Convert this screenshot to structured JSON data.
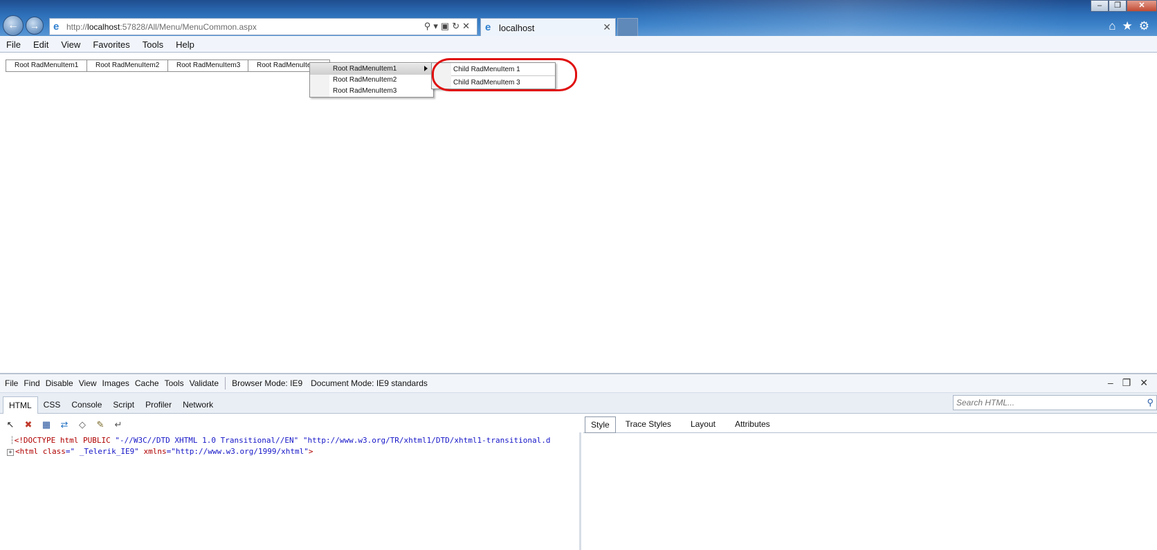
{
  "browser": {
    "address_prefix": "http://",
    "address_host": "localhost",
    "address_rest": ":57828/All/Menu/MenuCommon.aspx",
    "tab_title": "localhost",
    "menu": [
      "File",
      "Edit",
      "View",
      "Favorites",
      "Tools",
      "Help"
    ]
  },
  "radmenu": {
    "roots": [
      "Root RadMenuItem1",
      "Root RadMenuItem2",
      "Root RadMenuItem3",
      "Root RadMenuItem4"
    ],
    "submenu": [
      "Root RadMenuItem1",
      "Root RadMenuItem2",
      "Root RadMenuItem3"
    ],
    "child_submenu": [
      "Child RadMenuItem 1",
      "Child RadMenuItem 3"
    ]
  },
  "devtools": {
    "menu": [
      "File",
      "Find",
      "Disable",
      "View",
      "Images",
      "Cache",
      "Tools",
      "Validate"
    ],
    "browser_mode_label": "Browser Mode:",
    "browser_mode_value": "IE9",
    "document_mode_label": "Document Mode:",
    "document_mode_value": "IE9 standards",
    "tabs": [
      "HTML",
      "CSS",
      "Console",
      "Script",
      "Profiler",
      "Network"
    ],
    "search_placeholder": "Search HTML...",
    "right_tabs": [
      "Style",
      "Trace Styles",
      "Layout",
      "Attributes"
    ],
    "code": {
      "line1_doctype": "<!DOCTYPE html PUBLIC ",
      "line1_public": "\"-//W3C//DTD XHTML 1.0 Transitional//EN\"",
      "line1_url": " \"http://www.w3.org/TR/xhtml1/DTD/xhtml1-transitional.d",
      "line2_tag": "<html ",
      "line2_attr1": "class",
      "line2_val1": "=\" _Telerik_IE9\" ",
      "line2_attr2": "xmlns",
      "line2_val2": "=\"http://www.w3.org/1999/xhtml\"",
      "line2_close": ">"
    }
  },
  "icons": [
    "back-arrow-icon",
    "forward-arrow-icon",
    "ie-icon",
    "search-icon",
    "refresh-icon",
    "stop-icon",
    "home-icon",
    "favorites-star-icon",
    "gear-icon"
  ]
}
